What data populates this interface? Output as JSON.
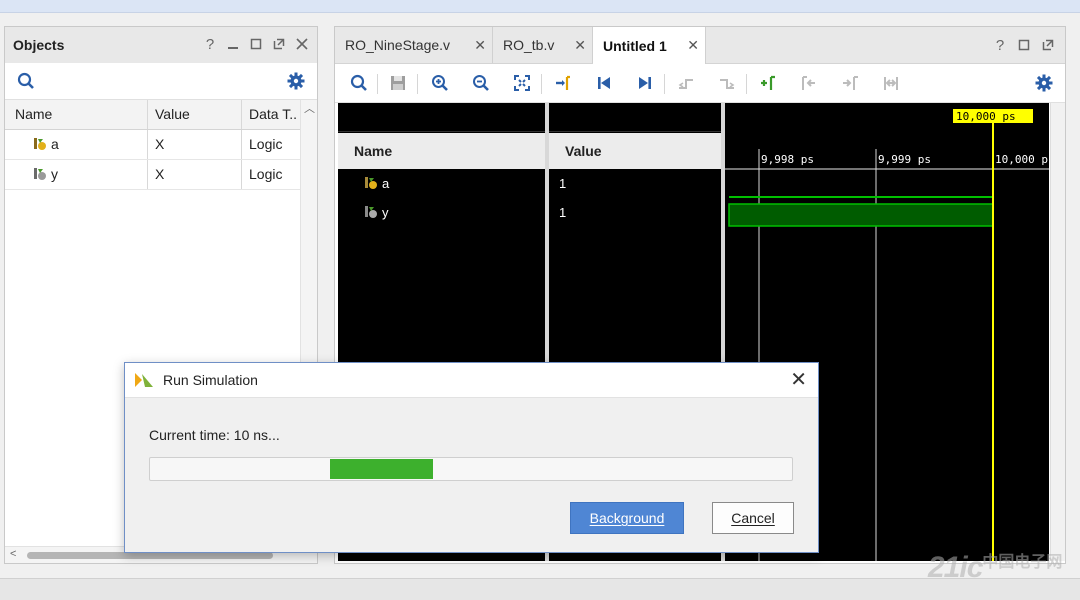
{
  "objects_panel": {
    "title": "Objects",
    "header_icons": [
      "help-icon",
      "minimize-icon",
      "maximize-icon",
      "float-icon",
      "close-icon"
    ],
    "toolbar": {
      "left": "search-icon",
      "right": "gear-icon"
    },
    "columns": [
      "Name",
      "Value",
      "Data T.."
    ],
    "rows": [
      {
        "name": "a",
        "value": "X",
        "type": "Logic"
      },
      {
        "name": "y",
        "value": "X",
        "type": "Logic"
      }
    ]
  },
  "wave_panel": {
    "tabs": [
      {
        "label": "RO_NineStage.v",
        "active": false
      },
      {
        "label": "RO_tb.v",
        "active": false
      },
      {
        "label": "Untitled 1",
        "active": true
      }
    ],
    "header_icons": [
      "help-icon",
      "maximize-icon",
      "float-icon"
    ],
    "toolbar_icons": [
      "search-icon",
      "save-icon",
      "zoom-in-icon",
      "zoom-out-icon",
      "zoom-fit-icon",
      "go-to-cursor-icon",
      "go-to-start-icon",
      "go-to-end-icon",
      "previous-transition-icon",
      "next-transition-icon",
      "add-marker-icon",
      "previous-marker-icon",
      "next-marker-icon",
      "swap-cursors-icon",
      "gear-icon"
    ],
    "name_header": "Name",
    "value_header": "Value",
    "signals": [
      {
        "name": "a",
        "value": "1"
      },
      {
        "name": "y",
        "value": "1"
      }
    ],
    "timeline": {
      "cursor_label": "10,000 ps",
      "ticks": [
        "9,998 ps",
        "9,999 ps",
        "10,000 p"
      ]
    },
    "colors": {
      "signal": "#00c000",
      "cursor": "#ffff00",
      "background": "#000000"
    }
  },
  "dialog": {
    "title": "Run Simulation",
    "status": "Current time: 10 ns...",
    "progress": {
      "start": 0.28,
      "end": 0.44
    },
    "buttons": {
      "primary": "Background",
      "secondary": "Cancel"
    },
    "colors": {
      "progress": "#3db02d",
      "primary_button": "#4f86d4"
    }
  },
  "watermark": {
    "text": "21ic",
    "sub": "中国电子网"
  }
}
